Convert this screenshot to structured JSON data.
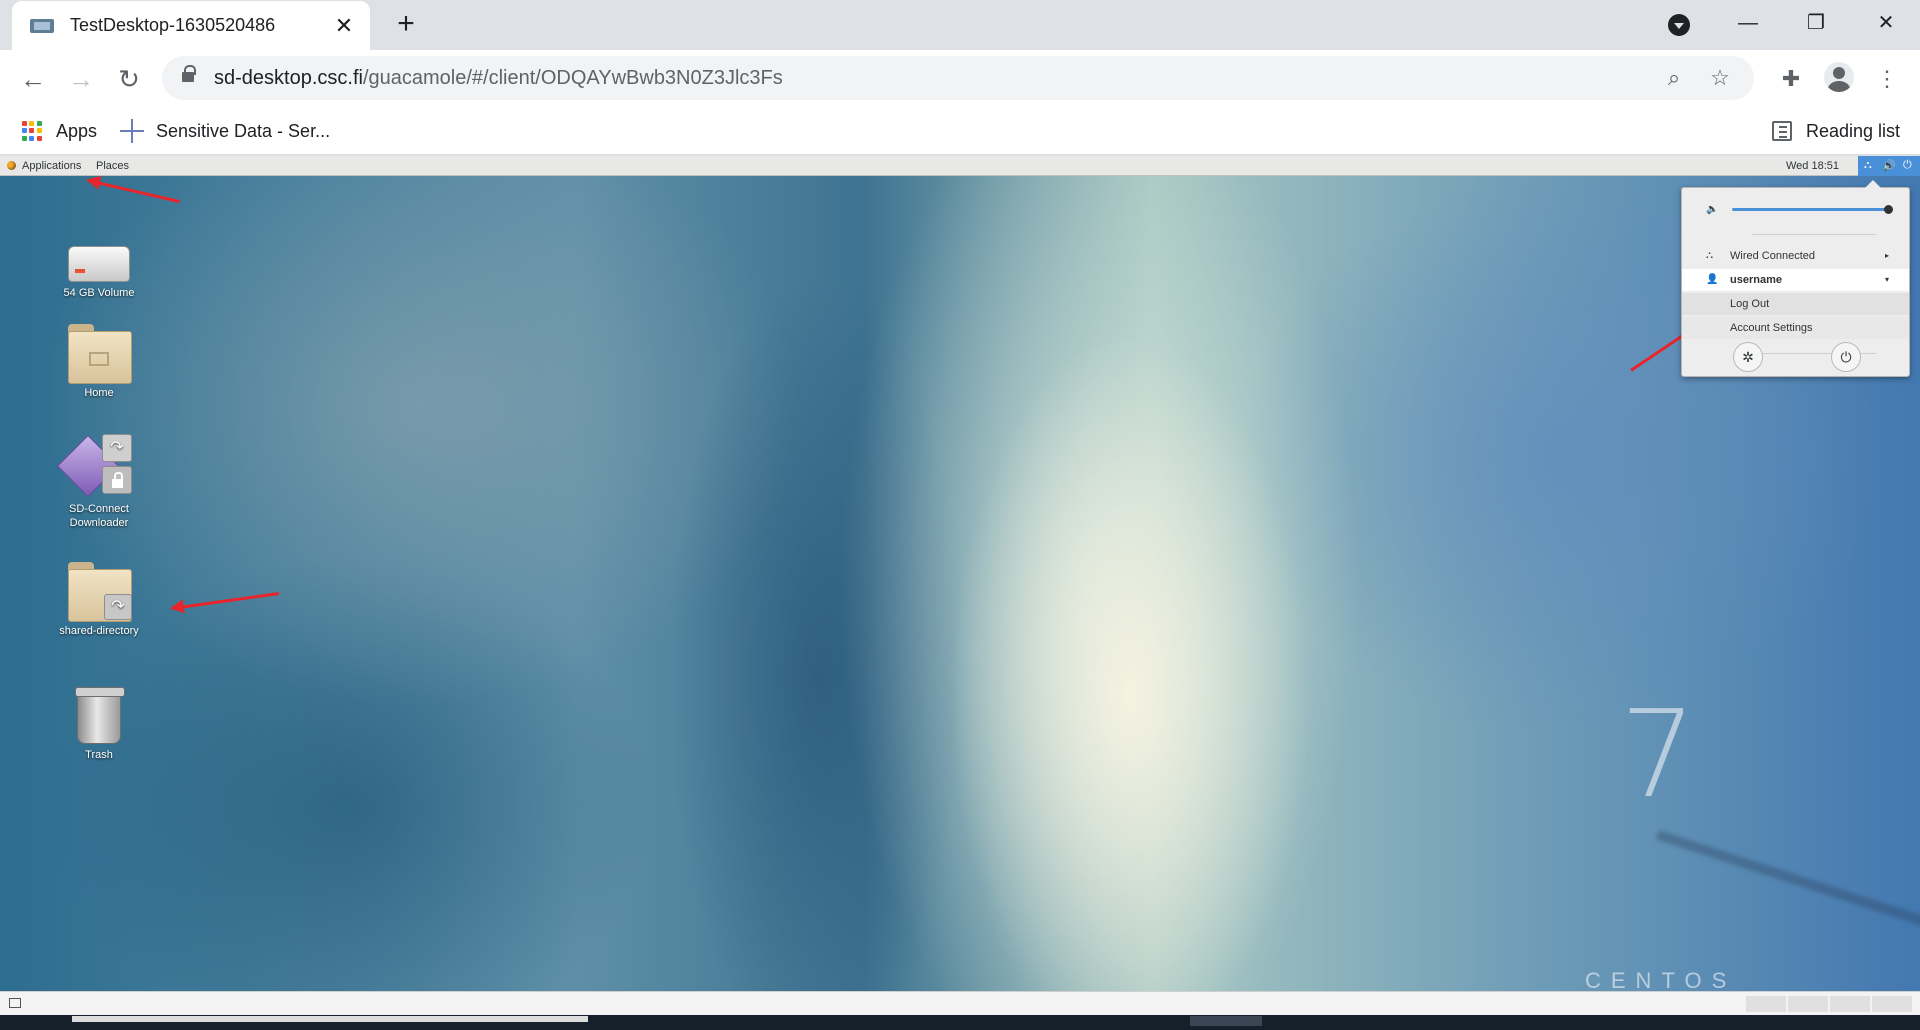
{
  "browser": {
    "tab_title": "TestDesktop-1630520486",
    "tab_close": "✕",
    "new_tab": "+",
    "window_min": "—",
    "window_restore": "❐",
    "window_close": "✕",
    "back": "←",
    "forward": "→",
    "reload": "↻",
    "url_host": "sd-desktop.csc.fi",
    "url_path": "/guacamole/#/client/ODQAYwBwb3N0Z3Jlc3Fs",
    "zoom_icon": "⌕",
    "bookmark_icon": "☆",
    "extensions_icon": "✚",
    "menu_icon": "⋮"
  },
  "bookmarks": {
    "apps": "Apps",
    "sensitive_data": "Sensitive Data - Ser...",
    "reading_list": "Reading list",
    "apps_colors": [
      "#ea4335",
      "#fbbc04",
      "#34a853",
      "#4285f4",
      "#ea4335",
      "#fbbc04",
      "#34a853",
      "#4285f4",
      "#ea4335"
    ]
  },
  "gnome_panel": {
    "applications": "Applications",
    "places": "Places",
    "clock": "Wed 18:51",
    "tray_network": "⛬",
    "tray_volume": "🔊",
    "tray_power": "⏻"
  },
  "desktop_icons": [
    {
      "label": "54 GB Volume"
    },
    {
      "label": "Home"
    },
    {
      "label": "SD-Connect\nDownloader"
    },
    {
      "label": "shared-directory"
    },
    {
      "label": "Trash"
    }
  ],
  "system_menu": {
    "volume_icon": "🔈",
    "volume_level": 1.0,
    "network_label": "Wired Connected",
    "network_icon": "⛬",
    "user_icon": "👤",
    "username": "username",
    "chevron_right": "▸",
    "chevron_down": "▾",
    "log_out": "Log Out",
    "account_settings": "Account Settings",
    "settings_icon": "✲",
    "power_icon": "⏻"
  },
  "wallpaper": {
    "logo_number": "7",
    "logo_word": "CENTOS"
  },
  "colors": {
    "annotation_arrow": "#e8252a",
    "tray_accent": "#4a90d9"
  }
}
